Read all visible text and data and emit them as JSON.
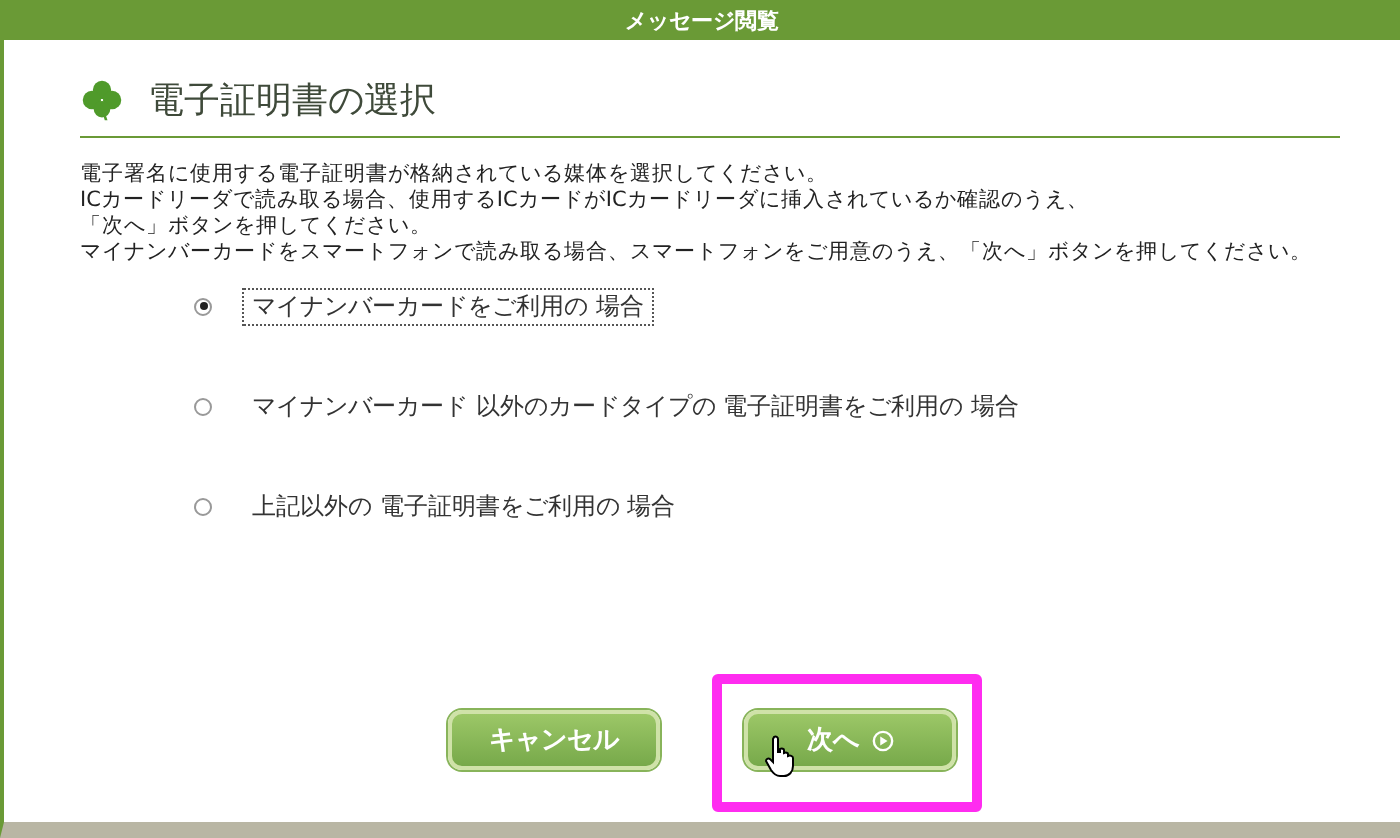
{
  "window": {
    "title": "メッセージ閲覧"
  },
  "heading": "電子証明書の選択",
  "instructions": [
    "電子署名に使用する電子証明書が格納されている媒体を選択してください。",
    "ICカードリーダで読み取る場合、使用するICカードがICカードリーダに挿入されているか確認のうえ、",
    "「次へ」ボタンを押してください。",
    "マイナンバーカードをスマートフォンで読み取る場合、スマートフォンをご用意のうえ、「次へ」ボタンを押してください。"
  ],
  "options": [
    {
      "label": "マイナンバーカードをご利用の 場合",
      "selected": true,
      "focused": true
    },
    {
      "label": "マイナンバーカード 以外のカードタイプの 電子証明書をご利用の 場合",
      "selected": false,
      "focused": false
    },
    {
      "label": "上記以外の 電子証明書をご利用の 場合",
      "selected": false,
      "focused": false
    }
  ],
  "buttons": [
    {
      "label": "キャンセル",
      "kind": "plain",
      "highlighted": false,
      "hovered": false
    },
    {
      "label": "次へ",
      "kind": "next",
      "highlighted": true,
      "hovered": true
    }
  ]
}
